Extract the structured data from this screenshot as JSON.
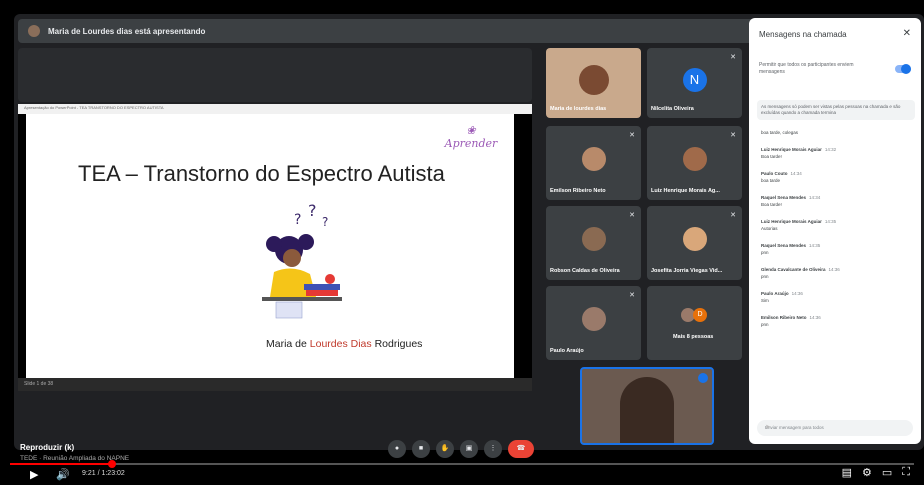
{
  "presenter_bar": {
    "text": "Maria de Lourdes dias está apresentando"
  },
  "slide": {
    "window_title": "Apresentação do PowerPoint - TEA TRANSTORNO DO ESPECTRO AUTISTA",
    "title": "TEA – Transtorno do Espectro Autista",
    "logo_text": "Aprender",
    "author_pre": "Maria de ",
    "author_hl": "Lourdes Dias",
    "author_post": " Rodrigues",
    "slide_counter": "Slide 1 de 38"
  },
  "tiles": [
    {
      "name": "Maria de lourdes dias"
    },
    {
      "name": "Nilcelita Oliveira",
      "initial": "N"
    },
    {
      "name": "Emilson Ribeiro Neto"
    },
    {
      "name": "Luiz Henrique Morais Ag..."
    },
    {
      "name": "Robson Caldas de Oliveira"
    },
    {
      "name": "Josefita Jorria Viegas Vid..."
    },
    {
      "name": "Paulo Araújo"
    },
    {
      "name": "Mais 8 pessoas"
    }
  ],
  "chat": {
    "header": "Mensagens na chamada",
    "allow_text": "Permitir que todos os participantes enviem mensagens",
    "info_text": "As mensagens só podem ser vistas pelas pessoas na chamada e são excluídas quando a chamada termina",
    "first_line": "boa tarde, colegas",
    "messages": [
      {
        "who": "Luiz Henrique Morais Aguiar",
        "time": "14:32",
        "text": "Boa tarde!"
      },
      {
        "who": "Paulo Couto",
        "time": "14:34",
        "text": "boa tarde"
      },
      {
        "who": "Raquel Sena Mendes",
        "time": "14:34",
        "text": "Boa tarde!"
      },
      {
        "who": "Luiz Henrique Morais Aguiar",
        "time": "14:35",
        "text": "Autorias"
      },
      {
        "who": "Raquel Sena Mendes",
        "time": "14:35",
        "text": "pnn"
      },
      {
        "who": "Glenda Cavalcante de Oliveira",
        "time": "14:36",
        "text": "pnn"
      },
      {
        "who": "Paulo Araújo",
        "time": "14:36",
        "text": "Sim"
      },
      {
        "who": "Emilson Ribeiro Neto",
        "time": "14:36",
        "text": "pnn"
      }
    ],
    "input_placeholder": "Enviar mensagem para todos"
  },
  "youtube": {
    "title": "Reproduzir (k)",
    "chapter": "TEDE · Reunião Ampliada do NAPNE",
    "time": "9:21 / 1:23:02",
    "progress": 0.113
  }
}
